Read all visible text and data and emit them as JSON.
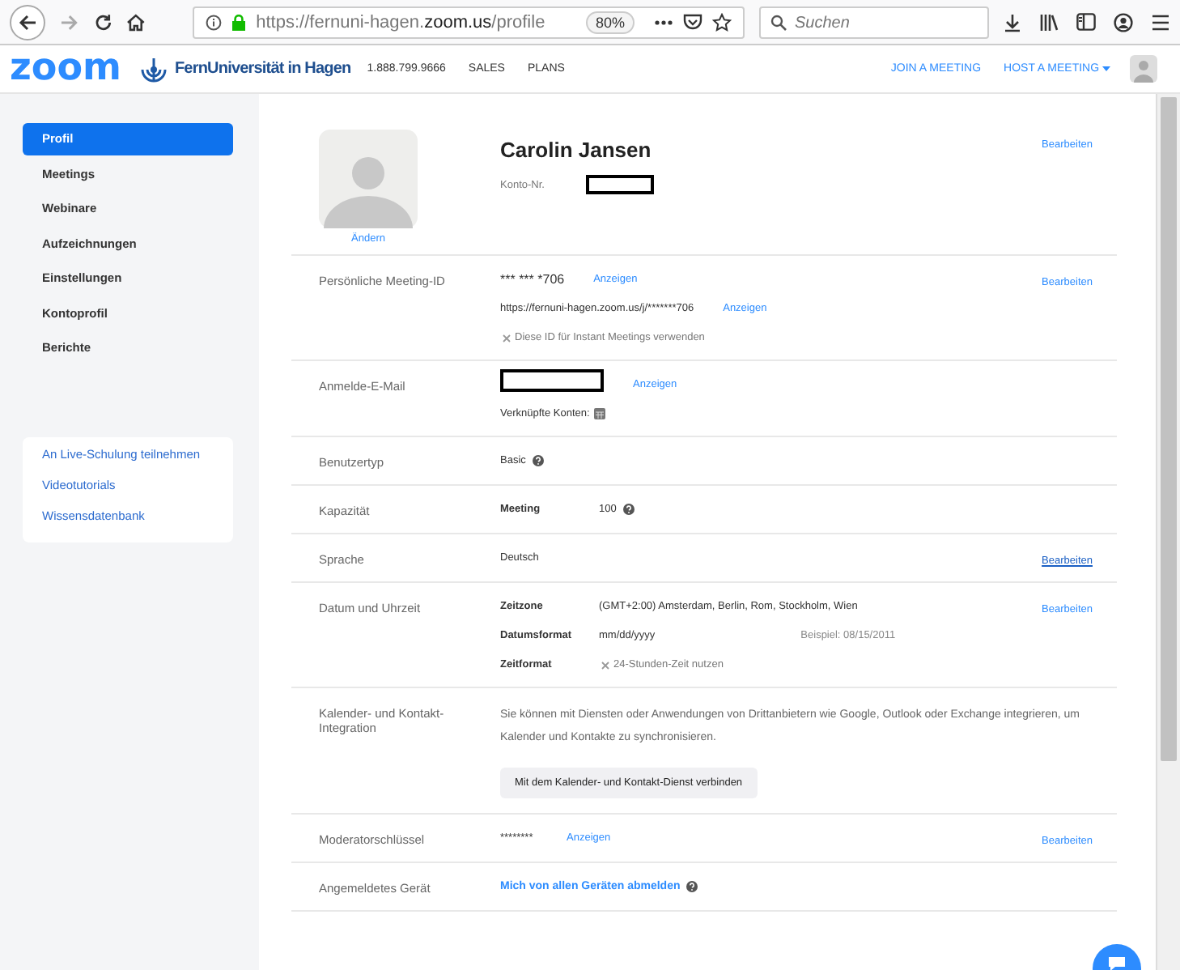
{
  "browser": {
    "url_start": "https://fernuni-hagen.",
    "url_domain": "zoom.us",
    "url_end": "/profile",
    "zoom": "80%",
    "search": {
      "placeholder": "Suchen"
    }
  },
  "header": {
    "logo": "zoom",
    "university": "FernUniversität in Hagen",
    "phone": "1.888.799.9666",
    "nav": [
      "SALES",
      "PLANS"
    ],
    "join": "JOIN A MEETING",
    "host": "HOST A MEETING"
  },
  "sidebar": {
    "items": [
      {
        "label": "Profil",
        "selected": true
      },
      {
        "label": "Meetings",
        "selected": false
      },
      {
        "label": "Webinare",
        "selected": false
      },
      {
        "label": "Aufzeichnungen",
        "selected": false
      },
      {
        "label": "Einstellungen",
        "selected": false
      },
      {
        "label": "Kontoprofil",
        "selected": false
      },
      {
        "label": "Berichte",
        "selected": false
      }
    ],
    "links": [
      "An Live-Schulung teilnehmen",
      "Videotutorials",
      "Wissensdatenbank"
    ]
  },
  "profile": {
    "name": "Carolin Jansen",
    "account_label": "Konto-Nr.",
    "change": "Ändern",
    "edit": {
      "text": "Bearbeiten",
      "hovered": false
    }
  },
  "sections": [
    {
      "label": "Persönliche Meeting-ID",
      "edit": {
        "text": "Bearbeiten",
        "hovered": false
      },
      "lines": [
        {
          "kind": "pair",
          "value": "*** *** *706",
          "show": "Anzeigen",
          "large": true
        },
        {
          "kind": "pair",
          "value": "https://fernuni-hagen.zoom.us/j/*******706",
          "show": "Anzeigen"
        },
        {
          "kind": "option",
          "text": "Diese ID für Instant Meetings verwenden",
          "checked": false
        }
      ]
    },
    {
      "label": "Anmelde-E-Mail",
      "lines": [
        {
          "kind": "redacted",
          "show": "Anzeigen"
        },
        {
          "kind": "accounts",
          "text": "Verknüpfte Konten:"
        }
      ]
    },
    {
      "label": "Benutzertyp",
      "lines": [
        {
          "kind": "pair",
          "value": "Basic",
          "help": true
        }
      ]
    },
    {
      "label": "Kapazität",
      "lines": [
        {
          "kind": "pair",
          "key": "Meeting",
          "value": "100",
          "help": true
        }
      ]
    },
    {
      "label": "Sprache",
      "edit": {
        "text": "Bearbeiten",
        "hovered": true
      },
      "lines": [
        {
          "kind": "pair",
          "value": "Deutsch"
        }
      ]
    },
    {
      "label": "Datum und Uhrzeit",
      "edit": {
        "text": "Bearbeiten",
        "hovered": false
      },
      "lines": [
        {
          "kind": "pair",
          "key": "Zeitzone",
          "value": "(GMT+2:00) Amsterdam, Berlin, Rom, Stockholm, Wien"
        },
        {
          "kind": "pair",
          "key": "Datumsformat",
          "value": "mm/dd/yyyy",
          "note": "Beispiel: 08/15/2011"
        },
        {
          "kind": "option",
          "key": "Zeitformat",
          "text": "24-Stunden-Zeit nutzen",
          "checked": false
        }
      ]
    },
    {
      "label": "Kalender- und Kontakt-Integration",
      "lines": [
        {
          "kind": "paragraph",
          "text": "Sie können mit Diensten oder Anwendungen von Drittanbietern wie Google, Outlook oder Exchange integrieren, um Kalender und Kontakte zu synchronisieren."
        },
        {
          "kind": "button",
          "text": "Mit dem Kalender- und Kontakt-Dienst verbinden"
        }
      ]
    },
    {
      "label": "Moderatorschlüssel",
      "edit": {
        "text": "Bearbeiten",
        "hovered": false
      },
      "lines": [
        {
          "kind": "pair",
          "value": "********",
          "show": "Anzeigen",
          "wide": true
        }
      ]
    },
    {
      "label": "Angemeldetes Gerät",
      "lines": [
        {
          "kind": "link",
          "text": "Mich von allen Geräten abmelden",
          "help": true
        }
      ]
    }
  ]
}
